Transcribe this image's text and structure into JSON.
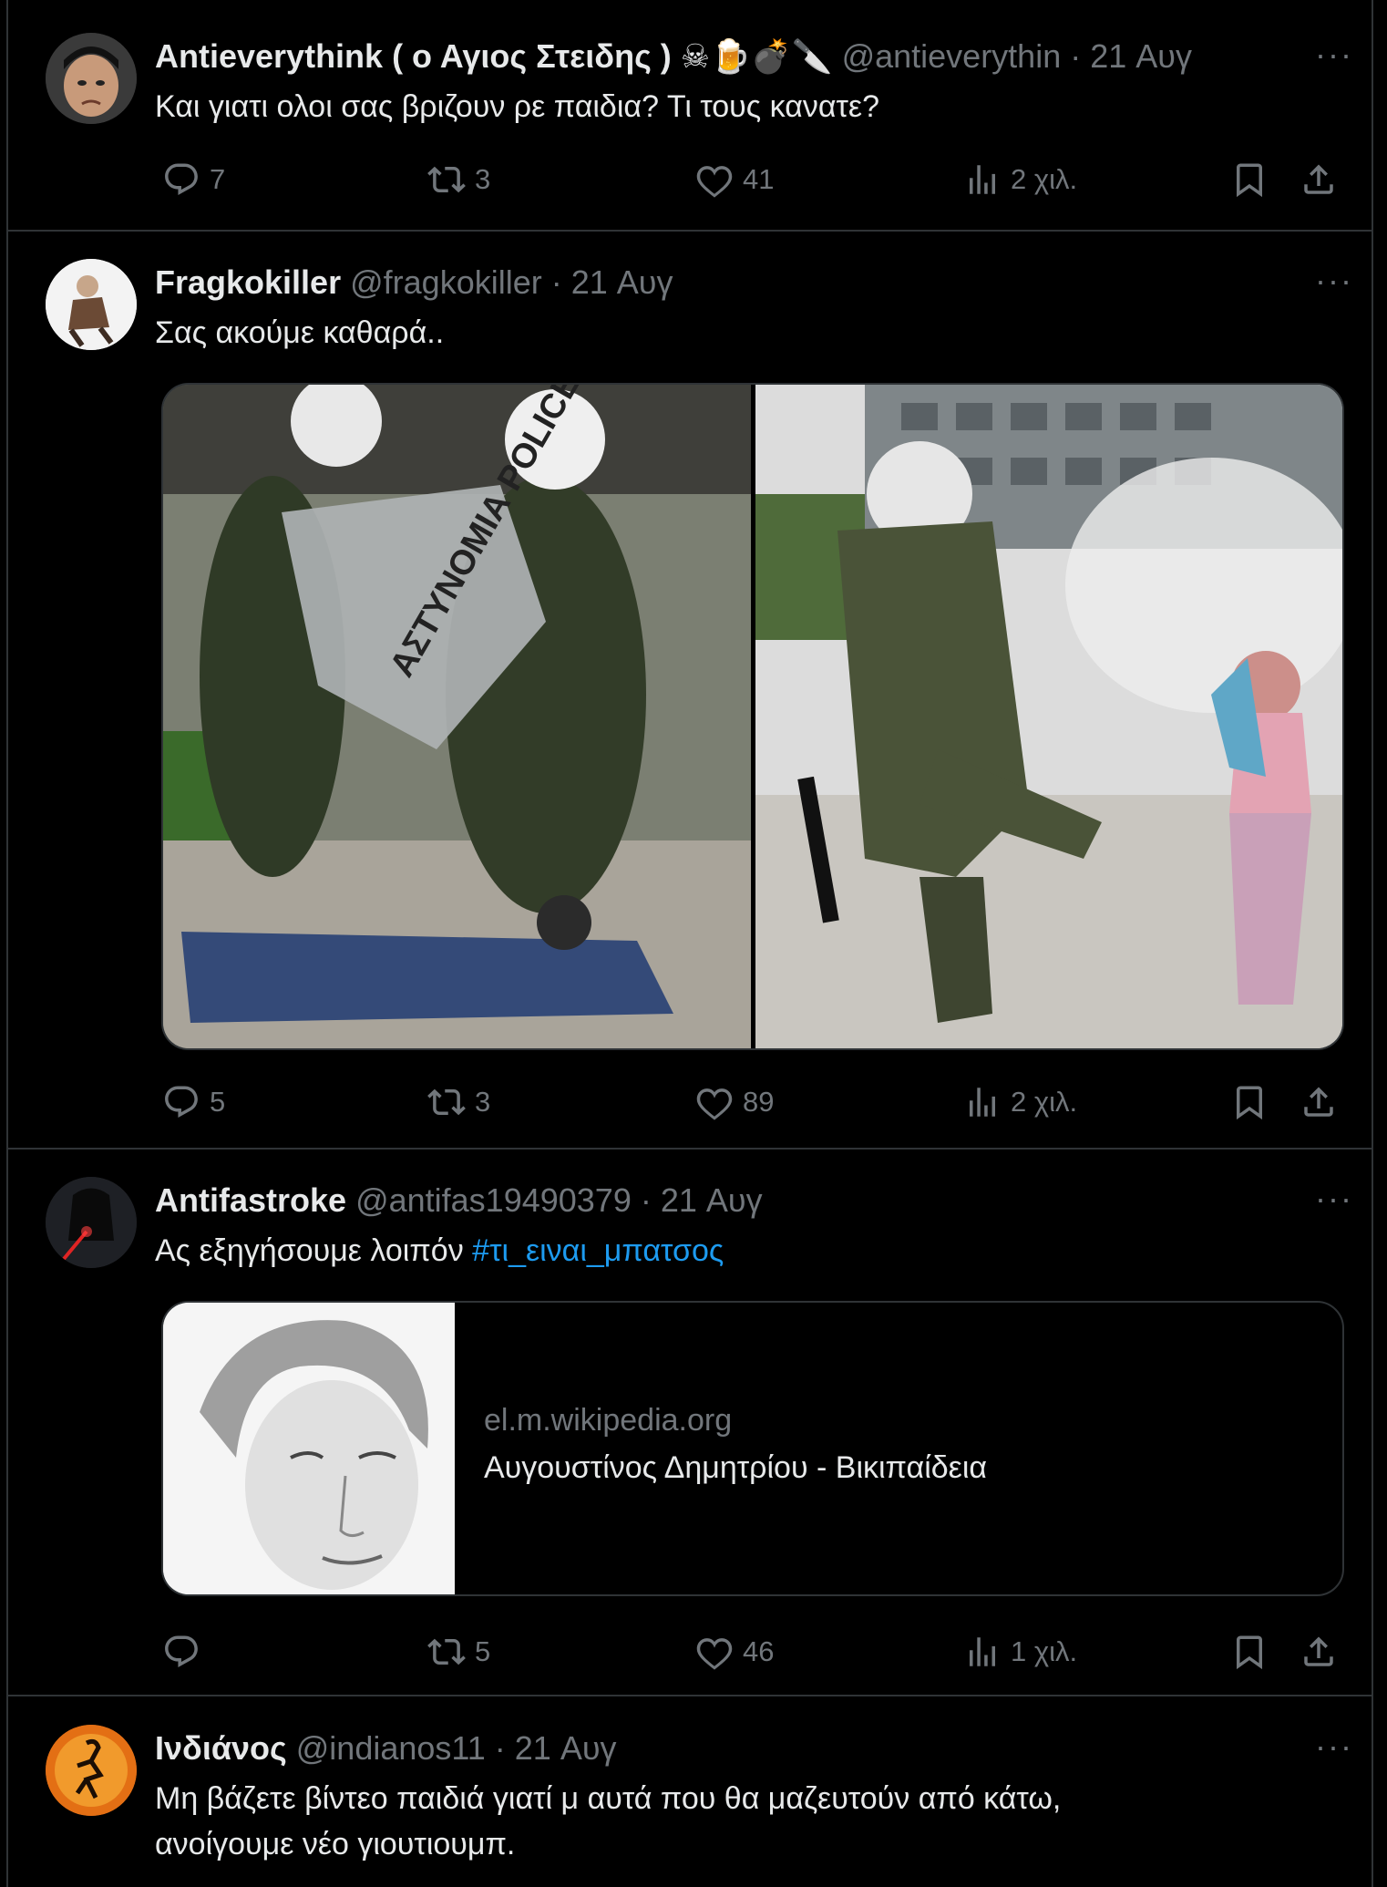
{
  "tweets": [
    {
      "name": "Antieverythink ( ο Αγιος Στειδης ) ☠🍺💣🔪",
      "handle": "@antieverythin",
      "date": "· 21 Αυγ",
      "text": "Και γιατι ολοι σας βριζουν ρε παιδια? Τι τους κανατε?",
      "replies": "7",
      "retweets": "3",
      "likes": "41",
      "views": "2 χιλ."
    },
    {
      "name": "Fragkokiller",
      "handle": "@fragkokiller",
      "date": "· 21 Αυγ",
      "text": "Σας ακούμε καθαρά..",
      "media_text": "ΑΣΤΥΝΟΜΙΑ POLICE",
      "replies": "5",
      "retweets": "3",
      "likes": "89",
      "views": "2 χιλ."
    },
    {
      "name": "Antifastroke",
      "handle": "@antifas19490379",
      "date": "· 21 Αυγ",
      "text": "Ας εξηγήσουμε λοιπόν",
      "hashtag": "#τι_ειναι_μπατσος",
      "card": {
        "domain": "el.m.wikipedia.org",
        "title": "Αυγουστίνος Δημητρίου - Βικιπαίδεια"
      },
      "replies": "",
      "retweets": "5",
      "likes": "46",
      "views": "1 χιλ."
    },
    {
      "name": "Ινδιάνος",
      "handle": "@indianos11",
      "date": "· 21 Αυγ",
      "text_line1": "Μη βάζετε βίντεο παιδιά γιατί μ αυτά που θα μαζευτούν από κάτω,",
      "text_line2": "ανοίγουμε νέο γιουτιουμπ."
    }
  ],
  "more_label": "···",
  "colors": {
    "text": "#e7e9ea",
    "muted": "#71767b",
    "link": "#1d9bf0",
    "border": "#2f3336",
    "bg": "#000000"
  }
}
